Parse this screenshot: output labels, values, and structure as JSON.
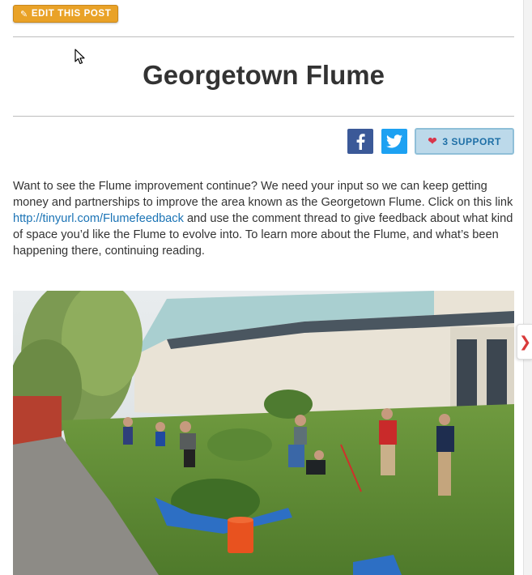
{
  "toolbar": {
    "edit_label": "EDIT THIS POST"
  },
  "post": {
    "title": "Georgetown Flume",
    "support_label": "3 SUPPORT",
    "body_before_link": "Want to see the Flume improvement continue? We need your input so we can keep getting money and partnerships to improve the area known as the Georgetown Flume. Click on this link ",
    "link_text": "http://tinyurl.com/Flumefeedback",
    "body_after_link": " and use the comment thread to give feedback about what kind of space you’d like the Flume to evolve into. To learn more about the Flume, and what’s been happening there, continuing reading."
  },
  "icons": {
    "edit": "pencil-icon",
    "facebook": "facebook-icon",
    "twitter": "twitter-icon",
    "support": "heart-icon",
    "next": "chevron-right-icon",
    "cursor": "mouse-pointer-icon"
  },
  "colors": {
    "edit_button": "#e9a227",
    "facebook": "#3b5998",
    "twitter": "#1da1f2",
    "support_bg": "#bcd9ea",
    "link": "#1a73b5"
  }
}
